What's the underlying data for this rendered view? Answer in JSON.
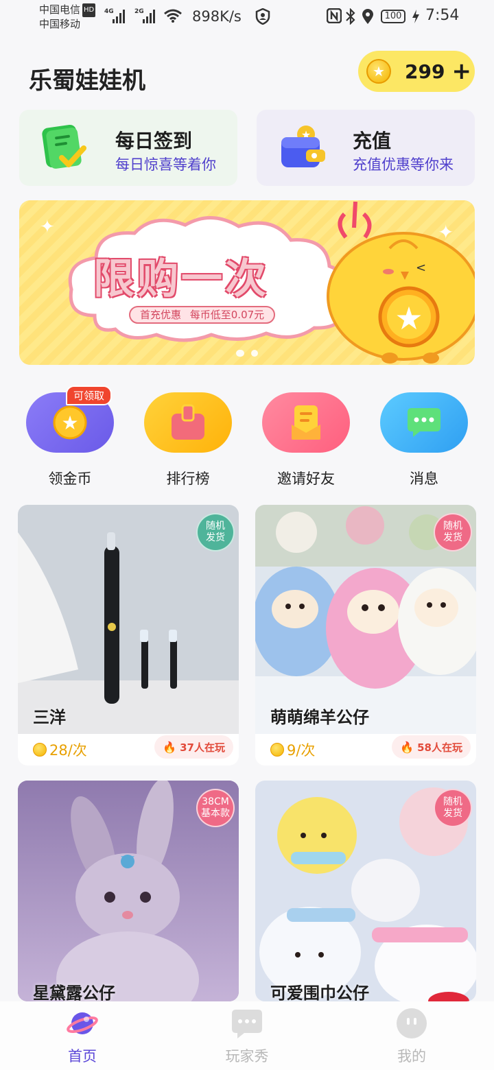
{
  "status_bar": {
    "carrier_1": "中国电信",
    "hd_badge": "HD",
    "carrier_2": "中国移动",
    "net_1": "4G",
    "net_2": "2G",
    "speed": "898K/s",
    "battery": "100",
    "time": "7:54"
  },
  "header": {
    "app_title": "乐蜀娃娃机",
    "coin_balance": "299",
    "coin_plus": "+"
  },
  "quick_cards": [
    {
      "title": "每日签到",
      "subtitle": "每日惊喜等着你",
      "icon": "checklist-icon"
    },
    {
      "title": "充值",
      "subtitle": "充值优惠等你来",
      "icon": "wallet-icon"
    }
  ],
  "banner": {
    "title": "限购一次",
    "subtitle": "首充优惠  每币低至0.07元",
    "dots": 2,
    "active_dot": 0
  },
  "shortcuts": [
    {
      "label": "领金币",
      "badge": "可领取",
      "icon": "coin-star-icon",
      "color": "#7a6cf2"
    },
    {
      "label": "排行榜",
      "badge": "",
      "icon": "ranking-bag-icon",
      "color": "#ffc21a"
    },
    {
      "label": "邀请好友",
      "badge": "",
      "icon": "invite-icon",
      "color": "#ff6f8b"
    },
    {
      "label": "消息",
      "badge": "",
      "icon": "message-icon",
      "color": "#3bb3f7"
    }
  ],
  "products": [
    {
      "name": "三洋",
      "price": "28/次",
      "players": "37人在玩",
      "badge_line1": "随机",
      "badge_line2": "发货",
      "badge_color": "#4fb49a"
    },
    {
      "name": "萌萌绵羊公仔",
      "price": "9/次",
      "players": "58人在玩",
      "badge_line1": "随机",
      "badge_line2": "发货",
      "badge_color": "#ef6a86"
    },
    {
      "name": "星黛露公仔",
      "price": "",
      "players": "",
      "badge_line1": "38CM",
      "badge_line2": "基本款",
      "badge_color": "#ef6a86"
    },
    {
      "name": "可爱围巾公仔",
      "price": "",
      "players": "",
      "badge_line1": "随机",
      "badge_line2": "发货",
      "badge_color": "#ef6a86"
    }
  ],
  "tabbar": {
    "items": [
      {
        "label": "首页",
        "active": true
      },
      {
        "label": "玩家秀",
        "active": false
      },
      {
        "label": "我的",
        "active": false
      }
    ],
    "active_color": "#5a46d8",
    "inactive_color": "#b8b8b8"
  }
}
